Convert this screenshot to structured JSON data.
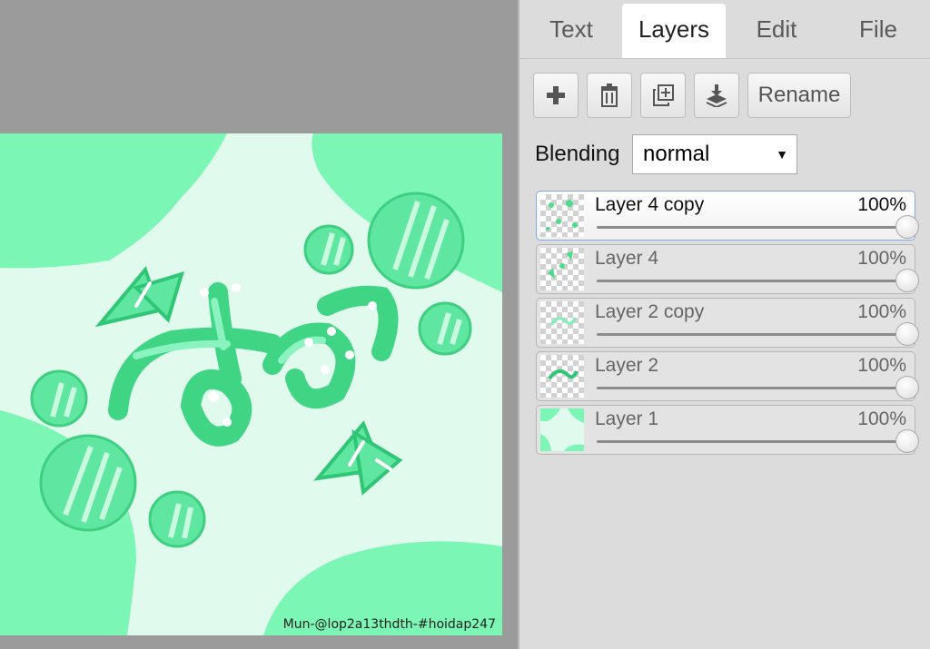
{
  "tabs": [
    {
      "label": "Text"
    },
    {
      "label": "Layers",
      "active": true
    },
    {
      "label": "Edit"
    },
    {
      "label": "File"
    }
  ],
  "toolbar": {
    "add_icon": "plus-icon",
    "delete_icon": "trash-icon",
    "duplicate_icon": "duplicate-icon",
    "merge_down_icon": "merge-down-icon",
    "rename_label": "Rename"
  },
  "blending": {
    "label": "Blending",
    "value": "normal"
  },
  "layers": [
    {
      "name": "Layer 4 copy",
      "opacity": "100%",
      "opacity_value": 1.0,
      "active": true
    },
    {
      "name": "Layer 4",
      "opacity": "100%",
      "opacity_value": 1.0
    },
    {
      "name": "Layer 2 copy",
      "opacity": "100%",
      "opacity_value": 1.0
    },
    {
      "name": "Layer 2",
      "opacity": "100%",
      "opacity_value": 1.0
    },
    {
      "name": "Layer 1",
      "opacity": "100%",
      "opacity_value": 1.0
    }
  ],
  "canvas": {
    "signature": "Mun-@lop2a13thdth-#hoidap247"
  },
  "colors": {
    "workspace_bg": "#9b9b9b",
    "panel_bg": "#dcdcdc",
    "canvas_light": "#e0fbee",
    "canvas_blob": "#7cf6b4",
    "art_green": "#4edc8c"
  }
}
